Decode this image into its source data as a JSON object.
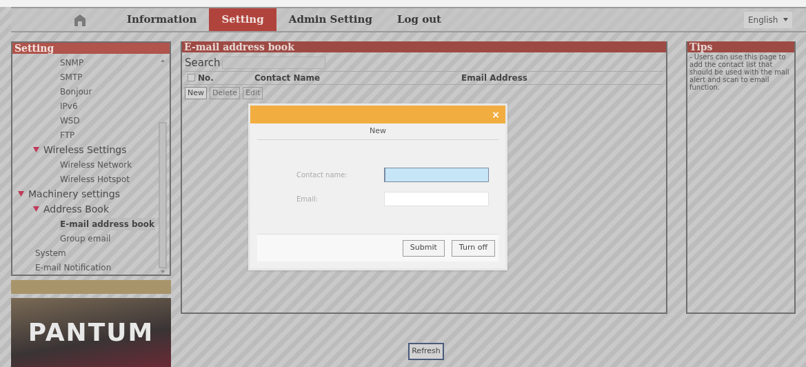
{
  "nav": {
    "items": [
      {
        "kind": "home",
        "selected": false
      },
      {
        "kind": "text",
        "label": "Information",
        "selected": false
      },
      {
        "kind": "text",
        "label": "Setting",
        "selected": true
      },
      {
        "kind": "text",
        "label": "Admin Setting",
        "selected": false
      },
      {
        "kind": "text",
        "label": "Log out",
        "selected": false
      }
    ],
    "language": "English"
  },
  "sidebar": {
    "title": "Setting",
    "tree": [
      {
        "children": [
          {
            "children": [
              {
                "label": "SNMP",
                "selected": false
              },
              {
                "label": "SMTP",
                "selected": false
              },
              {
                "label": "Bonjour",
                "selected": false
              },
              {
                "label": "IPv6",
                "selected": false
              },
              {
                "label": "WSD",
                "selected": false
              },
              {
                "label": "FTP",
                "selected": false
              }
            ]
          },
          {
            "label": "Wireless Settings",
            "expanded": true,
            "children": [
              {
                "label": "Wireless Network",
                "selected": false
              },
              {
                "label": "Wireless Hotspot",
                "selected": false
              }
            ]
          }
        ]
      },
      {
        "label": "Machinery settings",
        "expanded": true,
        "children": [
          {
            "label": "Address Book",
            "expanded": true,
            "children": [
              {
                "label": "E-mail address book",
                "selected": true
              },
              {
                "label": "Group email",
                "selected": false
              }
            ]
          },
          {
            "label": "System",
            "selected": false
          },
          {
            "label": "E-mail Notification",
            "selected": false
          }
        ]
      }
    ],
    "logo": "PANTUM"
  },
  "main": {
    "title": "E-mail address book",
    "search_label": "Search",
    "table": {
      "select_all_checked": false,
      "columns": [
        "No.",
        "Contact Name",
        "Email Address"
      ]
    },
    "buttons": [
      {
        "label": "New",
        "disabled": false
      },
      {
        "label": "Delete",
        "disabled": true
      },
      {
        "label": "Edit",
        "disabled": true
      }
    ],
    "refresh": "Refresh"
  },
  "tips": {
    "title": "Tips",
    "text": "- Users can use this page to add the contact list that should be used with the mail alert and scan to email function."
  },
  "dialog": {
    "close": "×",
    "title": "New",
    "fields": [
      {
        "label": "Contact name:",
        "focused": true
      },
      {
        "label": "Email:",
        "focused": false
      }
    ],
    "buttons": [
      "Submit",
      "Turn off"
    ]
  }
}
